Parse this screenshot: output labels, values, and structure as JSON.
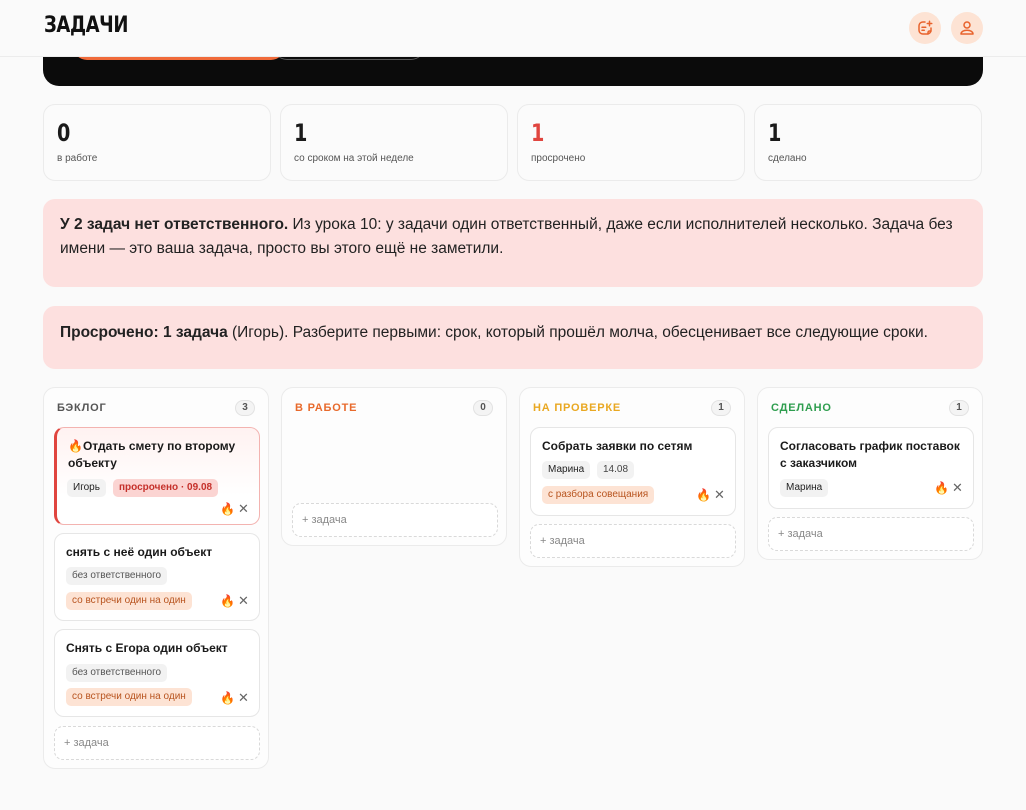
{
  "app": {
    "title": "ЗАДАЧИ"
  },
  "header": {
    "icons": [
      "note-add-icon",
      "user-icon"
    ]
  },
  "stats": [
    {
      "value": "0",
      "label": "в работе",
      "color": "#1a1a1a"
    },
    {
      "value": "1",
      "label": "со сроком на этой неделе",
      "color": "#1a1a1a"
    },
    {
      "value": "1",
      "label": "просрочено",
      "color": "#e0453f"
    },
    {
      "value": "1",
      "label": "сделано",
      "color": "#1a1a1a"
    }
  ],
  "alerts": [
    {
      "bold": "У 2 задач нет ответственного.",
      "text": " Из урока 10: у задачи один ответственный, даже если исполнителей несколько. Задача без имени — это ваша задача, просто вы этого ещё не заметили."
    },
    {
      "bold": "Просрочено: 1 задача",
      "text": " (Игорь). Разберите первыми: срок, который прошёл молча, обесценивает все следующие сроки."
    }
  ],
  "add_task_label": "+ задача",
  "columns": [
    {
      "title": "БЭКЛОГ",
      "count": "3",
      "color": "#555555",
      "cards": [
        {
          "title": "🔥Отдать смету по второму объекту",
          "assignee": "Игорь",
          "due": "просрочено · 09.08"
        },
        {
          "title": "снять с неё один объект",
          "assignee": "без ответственного",
          "source": "со встречи один на один"
        },
        {
          "title": "Снять с Егора один объект",
          "assignee": "без ответственного",
          "source": "со встречи один на один"
        }
      ]
    },
    {
      "title": "В РАБОТЕ",
      "count": "0",
      "color": "#e86a2c",
      "cards": []
    },
    {
      "title": "НА ПРОВЕРКЕ",
      "count": "1",
      "color": "#e9a822",
      "cards": [
        {
          "title": "Собрать заявки по сетям",
          "assignee": "Марина",
          "date": "14.08",
          "source": "с разбора совещания"
        }
      ]
    },
    {
      "title": "СДЕЛАНО",
      "count": "1",
      "color": "#2f9e4f",
      "cards": [
        {
          "title": "Согласовать график поставок с заказчиком",
          "assignee": "Марина"
        }
      ]
    }
  ]
}
